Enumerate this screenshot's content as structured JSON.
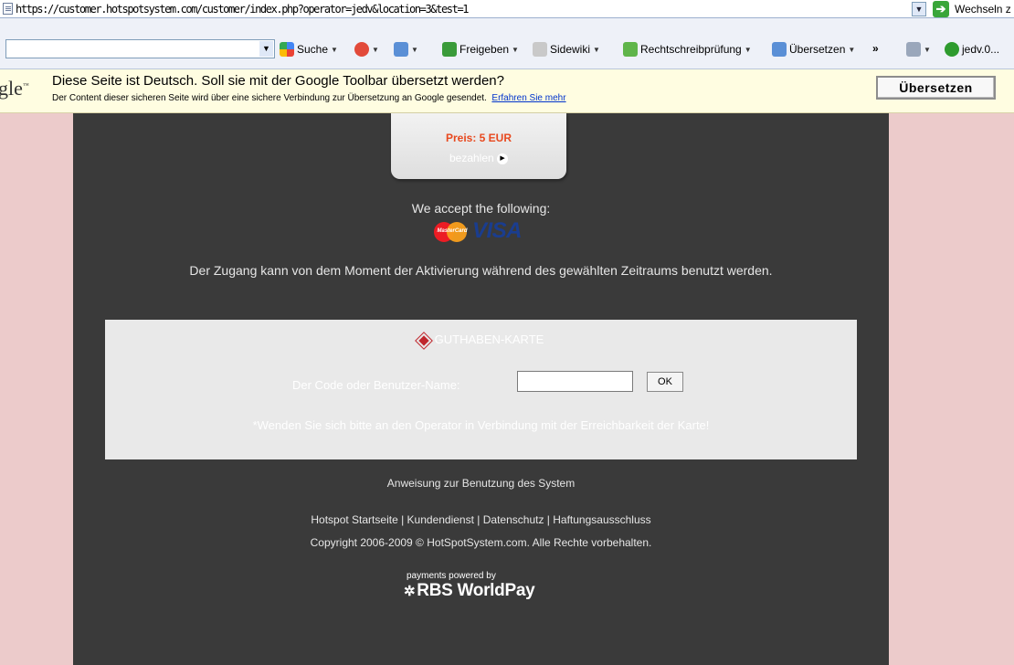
{
  "address_bar": {
    "url": "https://customer.hotspotsystem.com/customer/index.php?operator=jedv&location=3&test=1",
    "go_label": "Wechseln z"
  },
  "toolbar": {
    "search_label": "Suche",
    "share_label": "Freigeben",
    "sidewiki_label": "Sidewiki",
    "spellcheck_label": "Rechtschreibprüfung",
    "translate_label": "Übersetzen",
    "more_label": "»",
    "account_label": "jedv.0..."
  },
  "translate_bar": {
    "logo": "gle",
    "message": "Diese Seite ist Deutsch. Soll sie mit der Google Toolbar übersetzt werden?",
    "sub_message": "Der Content dieser sicheren Seite wird über eine sichere Verbindung zur Übersetzung an Google gesendet.",
    "learn_more": "Erfahren Sie mehr",
    "button": "Übersetzen"
  },
  "price_box": {
    "price": "Preis: 5 EUR",
    "pay": "bezahlen"
  },
  "accept_text": "We accept the following:",
  "cards": {
    "mastercard": "MasterCard",
    "visa": "VISA"
  },
  "usage_text": "Der Zugang kann von dem Moment der Aktivierung während des gewählten Zeitraums benutzt werden.",
  "card_box": {
    "heading": "GUTHABEN-KARTE",
    "code_label": "Der Code oder Benutzer-Name:",
    "code_value": "",
    "ok_button": "OK",
    "note": "*Wenden Sie sich bitte an den Operator in Verbindung mit der Erreichbarkeit der Karte!"
  },
  "footer": {
    "instructions": "Anweisung zur Benutzung des System",
    "links": [
      "Hotspot Startseite",
      "Kundendienst",
      "Datenschutz",
      "Haftungsausschluss"
    ],
    "copyright": "Copyright 2006-2009 © HotSpotSystem.com. Alle Rechte vorbehalten.",
    "powered_small": "payments powered by",
    "powered_big": "RBS WorldPay"
  },
  "colors": {
    "page_bg": "#eccbcb",
    "content_bg": "#3a3a3a",
    "price": "#e8491f",
    "card_box_bg": "#e9e9e9",
    "translate_bar_bg": "#fffde1"
  }
}
